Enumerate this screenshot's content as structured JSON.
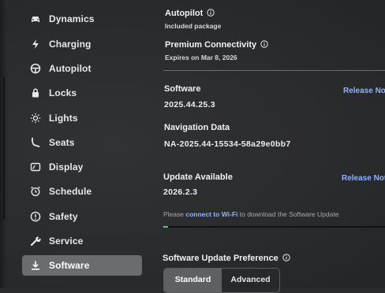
{
  "sidebar": {
    "items": [
      {
        "label": "Dynamics",
        "icon": "car-icon"
      },
      {
        "label": "Charging",
        "icon": "lightning-icon"
      },
      {
        "label": "Autopilot",
        "icon": "steering-wheel-icon"
      },
      {
        "label": "Locks",
        "icon": "lock-icon"
      },
      {
        "label": "Lights",
        "icon": "sun-icon"
      },
      {
        "label": "Seats",
        "icon": "seat-icon"
      },
      {
        "label": "Display",
        "icon": "display-icon"
      },
      {
        "label": "Schedule",
        "icon": "alarm-clock-icon"
      },
      {
        "label": "Safety",
        "icon": "alert-circle-icon"
      },
      {
        "label": "Service",
        "icon": "wrench-icon"
      },
      {
        "label": "Software",
        "icon": "download-icon",
        "active": true
      }
    ]
  },
  "autopilot": {
    "title": "Autopilot",
    "subtitle": "Included package"
  },
  "connectivity": {
    "title": "Premium Connectivity",
    "subtitle": "Expires on Mar 8, 2026"
  },
  "software": {
    "title": "Software",
    "version": "2025.44.25.3",
    "release_notes": "Release Notes"
  },
  "navigation": {
    "title": "Navigation Data",
    "version": "NA-2025.44-15534-58a29e0bb7"
  },
  "update": {
    "title": "Update Available",
    "version": "2026.2.3",
    "release_notes": "Release Notes",
    "notice_pre": "Please ",
    "notice_link": "connect to Wi-Fi",
    "notice_post": " to download the Software Update",
    "progress": 0.01
  },
  "preference": {
    "title": "Software Update Preference",
    "options": [
      "Standard",
      "Advanced"
    ],
    "selected": "Standard"
  },
  "colors": {
    "accent": "#8fb3ff",
    "active_bg": "#6b6c70",
    "progress": "#46c98a"
  }
}
